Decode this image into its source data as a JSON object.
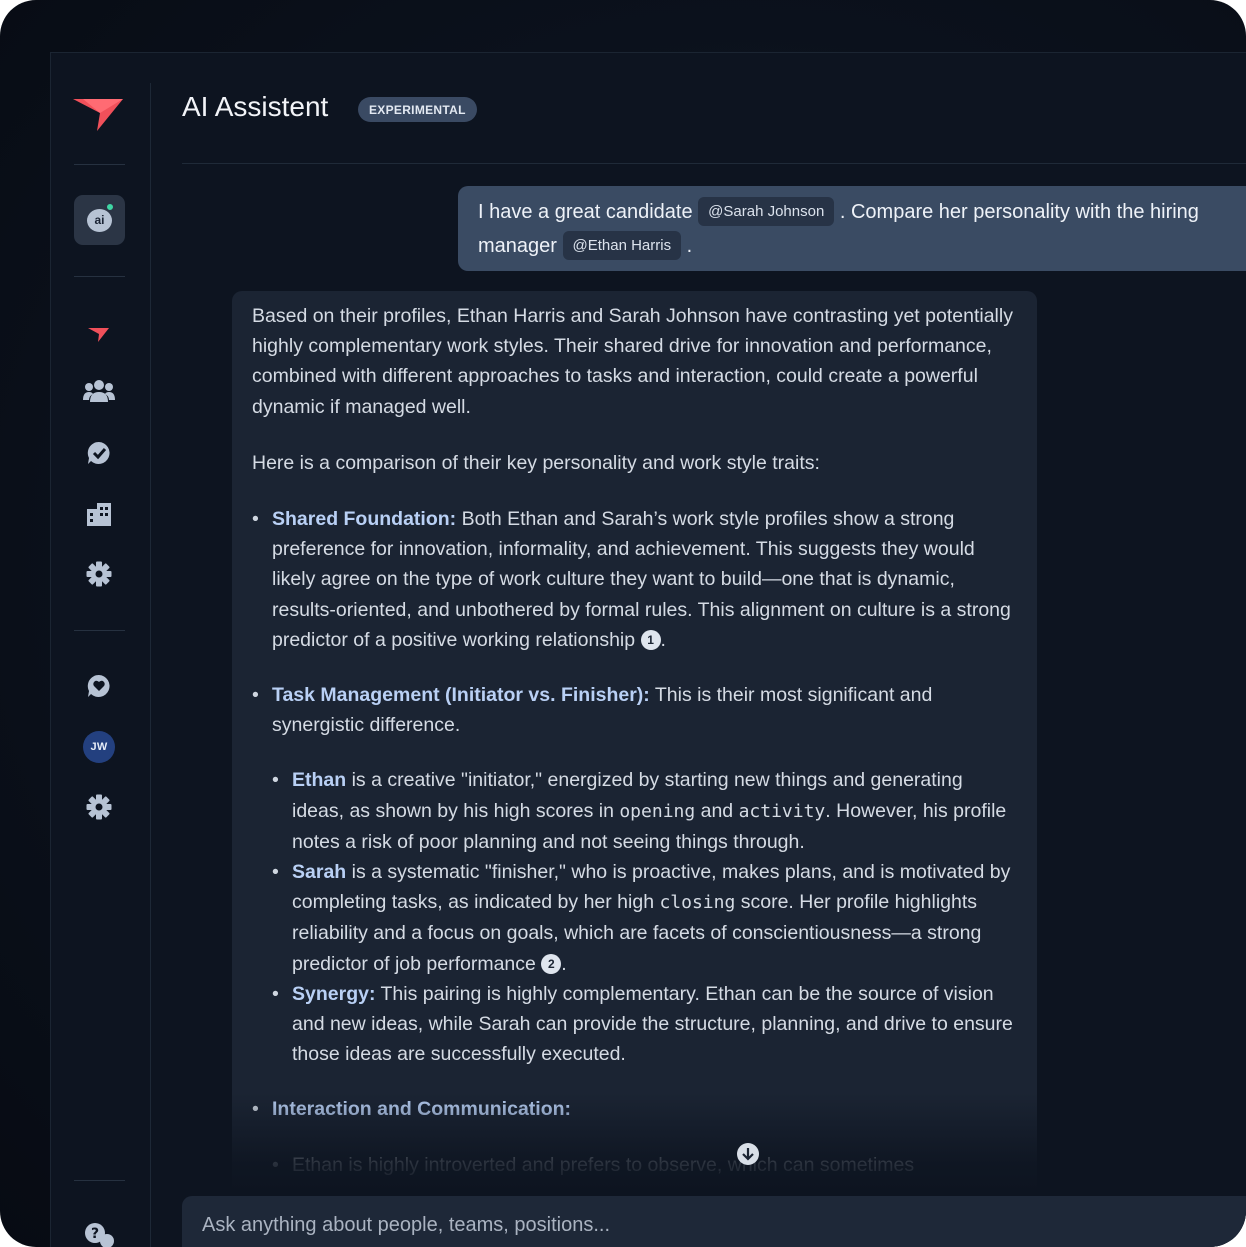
{
  "app": {
    "title": "AI Assistent",
    "badge": "EXPERIMENTAL"
  },
  "sidebar": {
    "ai_button_label": "ai",
    "avatar_initials": "JW",
    "icons": [
      "logo-icon",
      "ai-chat-icon",
      "brand-arrow-icon",
      "team-icon",
      "chat-check-icon",
      "building-icon",
      "gear-icon",
      "heart-chat-icon",
      "gear-icon",
      "help-icon"
    ]
  },
  "conversation": {
    "user_message": {
      "before_first_mention": "I have a great candidate ",
      "mention_1": "@Sarah Johnson",
      "between_mentions": " . Compare her personality with the hiring",
      "line2_prefix": "manager ",
      "mention_2": "@Ethan Harris",
      "end": " ."
    },
    "assistant_message": {
      "intro": "Based on their profiles, Ethan Harris and Sarah Johnson have contrasting yet potentially highly complementary work styles. Their shared drive for innovation and performance, combined with different approaches to tasks and interaction, could create a powerful dynamic if managed well.",
      "lead": "Here is a comparison of their key personality and work style traits:",
      "shared_title": "Shared Foundation:",
      "shared_text": " Both Ethan and Sarah’s work style profiles show a strong preference for innovation, informality, and achievement. This suggests they would likely agree on the type of work culture they want to build—one that is dynamic, results-oriented, and unbothered by formal rules. This alignment on culture is a strong predictor of a positive working relationship ",
      "cite_1": "1",
      "task_title": "Task Management (Initiator vs. Finisher):",
      "task_text": " This is their most significant and synergistic difference.",
      "ethan_name": "Ethan",
      "ethan_text_1": " is a creative \"initiator,\" energized by starting new things and generating ideas, as shown by his high scores in ",
      "code_opening": "opening",
      "ethan_and": " and ",
      "code_activity": "activity",
      "ethan_text_2": ". However, his profile notes a risk of poor planning and not seeing things through.",
      "sarah_name": "Sarah",
      "sarah_text_1": " is a systematic \"finisher,\" who is proactive, makes plans, and is motivated by completing tasks, as indicated by her high ",
      "code_closing": "closing",
      "sarah_text_2": " score. Her profile highlights reliability and a focus on goals, which are facets of conscientiousness—a strong predictor of job performance ",
      "cite_2": "2",
      "synergy_title": "Synergy:",
      "synergy_text": " This pairing is highly complementary. Ethan can be the source of vision and new ideas, while Sarah can provide the structure, planning, and drive to ensure those ideas are successfully executed.",
      "interaction_title": "Interaction and Communication:",
      "interaction_partial": "Ethan is highly introverted and prefers to observe, which can sometimes"
    }
  },
  "input": {
    "placeholder": "Ask anything about people, teams, positions..."
  },
  "colors": {
    "accent_red": "#f0505a",
    "badge_bg": "#3a4a63",
    "user_bubble": "#3a4b63",
    "assistant_bubble": "#1b2433",
    "highlight": "#b9d0f5",
    "status_dot": "#3fd6a4"
  }
}
